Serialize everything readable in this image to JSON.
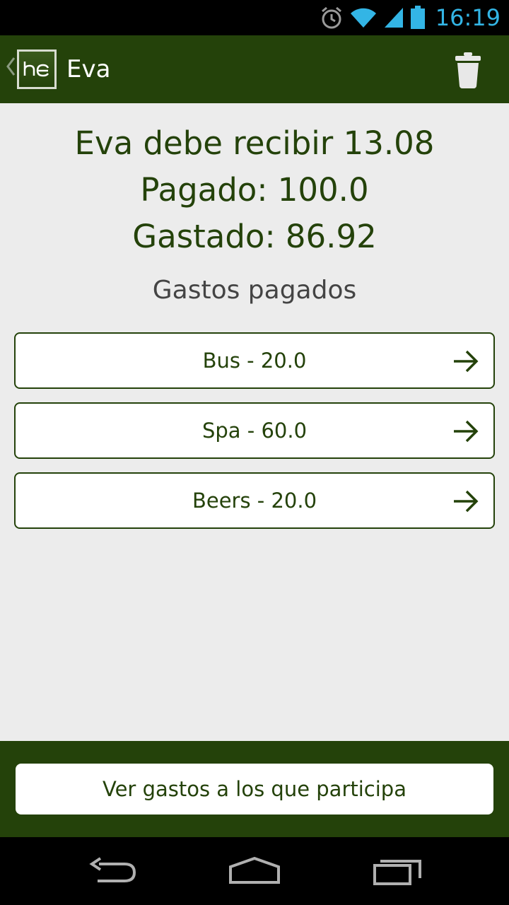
{
  "status_bar": {
    "time": "16:19",
    "icons": [
      "alarm-icon",
      "wifi-icon",
      "signal-icon",
      "battery-icon"
    ],
    "accent_color": "#33b5e5"
  },
  "action_bar": {
    "title": "Eva",
    "logo_text": "hc",
    "background_color": "#24420a",
    "icons": [
      "back-caret-icon",
      "trash-icon"
    ]
  },
  "summary": {
    "balance_line": "Eva debe recibir 13.08",
    "paid_line": "Pagado: 100.0",
    "spent_line": "Gastado: 86.92"
  },
  "expenses": {
    "section_title": "Gastos pagados",
    "items": [
      {
        "label": "Bus - 20.0"
      },
      {
        "label": "Spa - 60.0"
      },
      {
        "label": "Beers - 20.0"
      }
    ]
  },
  "bottom": {
    "participate_button": "Ver gastos a los que participa"
  },
  "nav_bar": {
    "buttons": [
      "back-icon",
      "home-icon",
      "recents-icon"
    ]
  }
}
